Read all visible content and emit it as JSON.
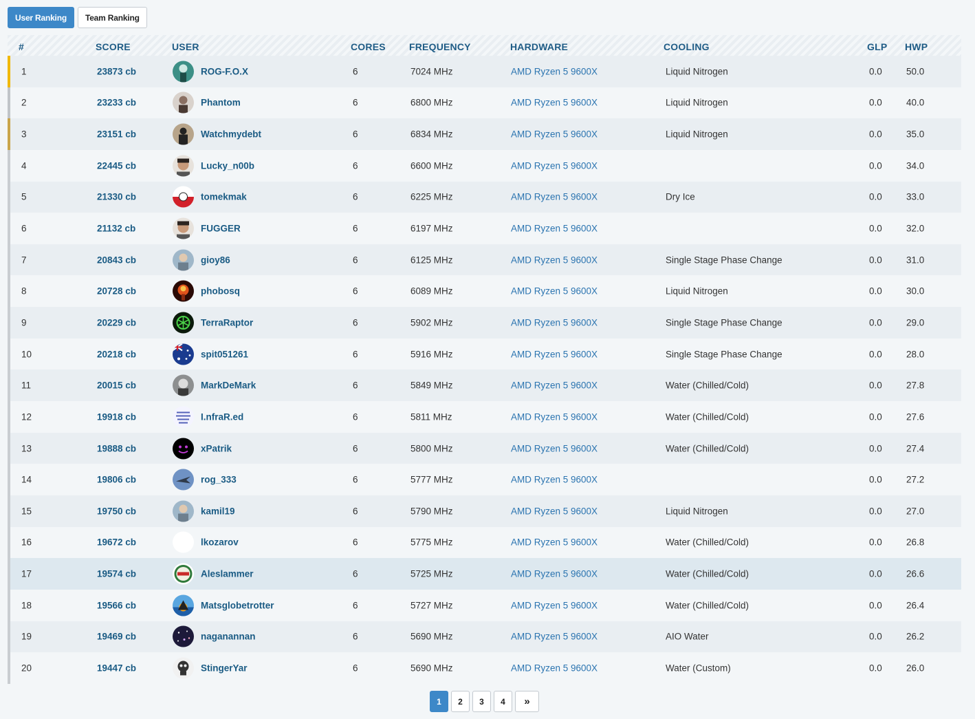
{
  "tabs": {
    "user_ranking": "User Ranking",
    "team_ranking": "Team Ranking"
  },
  "columns": {
    "rank": "#",
    "score": "SCORE",
    "user": "USER",
    "cores": "CORES",
    "frequency": "FREQUENCY",
    "hardware": "HARDWARE",
    "cooling": "COOLING",
    "glp": "GLP",
    "hwp": "HWP"
  },
  "colors": {
    "accent": "#3d88c8",
    "link": "#1a5b84",
    "gold": "#f0b800",
    "silver": "#c0c4c8",
    "bronze": "#c9a54b"
  },
  "rows": [
    {
      "rank": "1",
      "score": "23873 cb",
      "user": "ROG-F.O.X",
      "cores": "6",
      "frequency": "7024 MHz",
      "hardware": "AMD Ryzen 5 9600X",
      "cooling": "Liquid Nitrogen",
      "glp": "0.0",
      "hwp": "50.0",
      "avatar": "teal-figure-avatar"
    },
    {
      "rank": "2",
      "score": "23233 cb",
      "user": "Phantom",
      "cores": "6",
      "frequency": "6800 MHz",
      "hardware": "AMD Ryzen 5 9600X",
      "cooling": "Liquid Nitrogen",
      "glp": "0.0",
      "hwp": "40.0",
      "avatar": "person-avatar"
    },
    {
      "rank": "3",
      "score": "23151 cb",
      "user": "Watchmydebt",
      "cores": "6",
      "frequency": "6834 MHz",
      "hardware": "AMD Ryzen 5 9600X",
      "cooling": "Liquid Nitrogen",
      "glp": "0.0",
      "hwp": "35.0",
      "avatar": "silhouette-avatar"
    },
    {
      "rank": "4",
      "score": "22445 cb",
      "user": "Lucky_n00b",
      "cores": "6",
      "frequency": "6600 MHz",
      "hardware": "AMD Ryzen 5 9600X",
      "cooling": "",
      "glp": "0.0",
      "hwp": "34.0",
      "avatar": "face-avatar"
    },
    {
      "rank": "5",
      "score": "21330 cb",
      "user": "tomekmak",
      "cores": "6",
      "frequency": "6225 MHz",
      "hardware": "AMD Ryzen 5 9600X",
      "cooling": "Dry Ice",
      "glp": "0.0",
      "hwp": "33.0",
      "avatar": "red-white-avatar"
    },
    {
      "rank": "6",
      "score": "21132 cb",
      "user": "FUGGER",
      "cores": "6",
      "frequency": "6197 MHz",
      "hardware": "AMD Ryzen 5 9600X",
      "cooling": "",
      "glp": "0.0",
      "hwp": "32.0",
      "avatar": "face-avatar"
    },
    {
      "rank": "7",
      "score": "20843 cb",
      "user": "gioy86",
      "cores": "6",
      "frequency": "6125 MHz",
      "hardware": "AMD Ryzen 5 9600X",
      "cooling": "Single Stage Phase Change",
      "glp": "0.0",
      "hwp": "31.0",
      "avatar": "photo-avatar"
    },
    {
      "rank": "8",
      "score": "20728 cb",
      "user": "phobosq",
      "cores": "6",
      "frequency": "6089 MHz",
      "hardware": "AMD Ryzen 5 9600X",
      "cooling": "Liquid Nitrogen",
      "glp": "0.0",
      "hwp": "30.0",
      "avatar": "explosion-avatar"
    },
    {
      "rank": "9",
      "score": "20229 cb",
      "user": "TerraRaptor",
      "cores": "6",
      "frequency": "5902 MHz",
      "hardware": "AMD Ryzen 5 9600X",
      "cooling": "Single Stage Phase Change",
      "glp": "0.0",
      "hwp": "29.0",
      "avatar": "green-symbol-avatar"
    },
    {
      "rank": "10",
      "score": "20218 cb",
      "user": "spit051261",
      "cores": "6",
      "frequency": "5916 MHz",
      "hardware": "AMD Ryzen 5 9600X",
      "cooling": "Single Stage Phase Change",
      "glp": "0.0",
      "hwp": "28.0",
      "avatar": "australia-flag-avatar"
    },
    {
      "rank": "11",
      "score": "20015 cb",
      "user": "MarkDeMark",
      "cores": "6",
      "frequency": "5849 MHz",
      "hardware": "AMD Ryzen 5 9600X",
      "cooling": "Water (Chilled/Cold)",
      "glp": "0.0",
      "hwp": "27.8",
      "avatar": "grey-avatar"
    },
    {
      "rank": "12",
      "score": "19918 cb",
      "user": "I.nfraR.ed",
      "cores": "6",
      "frequency": "5811 MHz",
      "hardware": "AMD Ryzen 5 9600X",
      "cooling": "Water (Chilled/Cold)",
      "glp": "0.0",
      "hwp": "27.6",
      "avatar": "text-avatar"
    },
    {
      "rank": "13",
      "score": "19888 cb",
      "user": "xPatrik",
      "cores": "6",
      "frequency": "5800 MHz",
      "hardware": "AMD Ryzen 5 9600X",
      "cooling": "Water (Chilled/Cold)",
      "glp": "0.0",
      "hwp": "27.4",
      "avatar": "black-face-avatar"
    },
    {
      "rank": "14",
      "score": "19806 cb",
      "user": "rog_333",
      "cores": "6",
      "frequency": "5777 MHz",
      "hardware": "AMD Ryzen 5 9600X",
      "cooling": "",
      "glp": "0.0",
      "hwp": "27.2",
      "avatar": "jet-avatar"
    },
    {
      "rank": "15",
      "score": "19750 cb",
      "user": "kamil19",
      "cores": "6",
      "frequency": "5790 MHz",
      "hardware": "AMD Ryzen 5 9600X",
      "cooling": "Liquid Nitrogen",
      "glp": "0.0",
      "hwp": "27.0",
      "avatar": "photo-avatar"
    },
    {
      "rank": "16",
      "score": "19672 cb",
      "user": "lkozarov",
      "cores": "6",
      "frequency": "5775 MHz",
      "hardware": "AMD Ryzen 5 9600X",
      "cooling": "Water (Chilled/Cold)",
      "glp": "0.0",
      "hwp": "26.8",
      "avatar": "blank-avatar"
    },
    {
      "rank": "17",
      "score": "19574 cb",
      "user": "Aleslammer",
      "cores": "6",
      "frequency": "5725 MHz",
      "hardware": "AMD Ryzen 5 9600X",
      "cooling": "Water (Chilled/Cold)",
      "glp": "0.0",
      "hwp": "26.6",
      "avatar": "badge-avatar"
    },
    {
      "rank": "18",
      "score": "19566 cb",
      "user": "Matsglobetrotter",
      "cores": "6",
      "frequency": "5727 MHz",
      "hardware": "AMD Ryzen 5 9600X",
      "cooling": "Water (Chilled/Cold)",
      "glp": "0.0",
      "hwp": "26.4",
      "avatar": "sunset-avatar"
    },
    {
      "rank": "19",
      "score": "19469 cb",
      "user": "naganannan",
      "cores": "6",
      "frequency": "5690 MHz",
      "hardware": "AMD Ryzen 5 9600X",
      "cooling": "AIO Water",
      "glp": "0.0",
      "hwp": "26.2",
      "avatar": "galaxy-avatar"
    },
    {
      "rank": "20",
      "score": "19447 cb",
      "user": "StingerYar",
      "cores": "6",
      "frequency": "5690 MHz",
      "hardware": "AMD Ryzen 5 9600X",
      "cooling": "Water (Custom)",
      "glp": "0.0",
      "hwp": "26.0",
      "avatar": "skull-avatar"
    }
  ],
  "pagination": {
    "pages": [
      "1",
      "2",
      "3",
      "4"
    ],
    "current": "1",
    "next_label": "»"
  }
}
